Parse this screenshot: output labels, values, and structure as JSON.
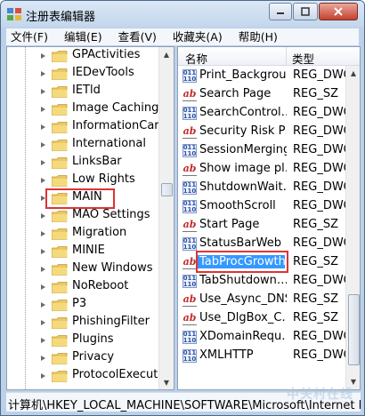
{
  "window": {
    "title": "注册表编辑器",
    "buttons": [
      "minimize",
      "maximize",
      "close"
    ]
  },
  "menu": [
    "文件(F)",
    "编辑(E)",
    "查看(V)",
    "收藏夹(A)",
    "帮助(H)"
  ],
  "tree": {
    "items": [
      {
        "label": "GPActivities"
      },
      {
        "label": "IEDevTools"
      },
      {
        "label": "IETld"
      },
      {
        "label": "Image Caching"
      },
      {
        "label": "InformationCard"
      },
      {
        "label": "International"
      },
      {
        "label": "LinksBar"
      },
      {
        "label": "Low Rights"
      },
      {
        "label": "MAIN",
        "highlighted": true
      },
      {
        "label": "MAO Settings"
      },
      {
        "label": "Migration"
      },
      {
        "label": "MINIE"
      },
      {
        "label": "New Windows"
      },
      {
        "label": "NoReboot"
      },
      {
        "label": "P3"
      },
      {
        "label": "PhishingFilter"
      },
      {
        "label": "Plugins"
      },
      {
        "label": "Privacy"
      },
      {
        "label": "ProtocolExecute"
      }
    ]
  },
  "list": {
    "columns": {
      "name": "名称",
      "type": "类型"
    },
    "rows": [
      {
        "icon": "binary-value-icon",
        "name": "Print_Backgrou…",
        "type": "REG_DWC"
      },
      {
        "icon": "string-value-icon",
        "name": "Search Page",
        "type": "REG_SZ"
      },
      {
        "icon": "binary-value-icon",
        "name": "SearchControl…",
        "type": "REG_DWC"
      },
      {
        "icon": "string-value-icon",
        "name": "Security Risk P…",
        "type": "REG_DWC"
      },
      {
        "icon": "binary-value-icon",
        "name": "SessionMerging",
        "type": "REG_DWC"
      },
      {
        "icon": "string-value-icon",
        "name": "Show image pl…",
        "type": "REG_DWC"
      },
      {
        "icon": "binary-value-icon",
        "name": "ShutdownWait…",
        "type": "REG_DWC"
      },
      {
        "icon": "binary-value-icon",
        "name": "SmoothScroll",
        "type": "REG_DWC"
      },
      {
        "icon": "string-value-icon",
        "name": "Start Page",
        "type": "REG_SZ"
      },
      {
        "icon": "binary-value-icon",
        "name": "StatusBarWeb",
        "type": "REG_DWC"
      },
      {
        "icon": "string-value-icon",
        "name": "TabProcGrowth",
        "type": "REG_SZ",
        "selected": true
      },
      {
        "icon": "binary-value-icon",
        "name": "TabShutdown…",
        "type": "REG_DWC"
      },
      {
        "icon": "string-value-icon",
        "name": "Use_Async_DNS",
        "type": "REG_SZ"
      },
      {
        "icon": "string-value-icon",
        "name": "Use_DlgBox_C…",
        "type": "REG_SZ"
      },
      {
        "icon": "binary-value-icon",
        "name": "XDomainRequ…",
        "type": "REG_DWC"
      },
      {
        "icon": "binary-value-icon",
        "name": "XMLHTTP",
        "type": "REG_DWC"
      }
    ]
  },
  "statusbar": {
    "path": "计算机\\HKEY_LOCAL_MACHINE\\SOFTWARE\\Microsoft\\Internet Ex"
  },
  "watermark": "中关村在线",
  "colors": {
    "highlight_box": "#e03232",
    "selection": "#3399ff",
    "title_bar": "#c2d6ec"
  }
}
